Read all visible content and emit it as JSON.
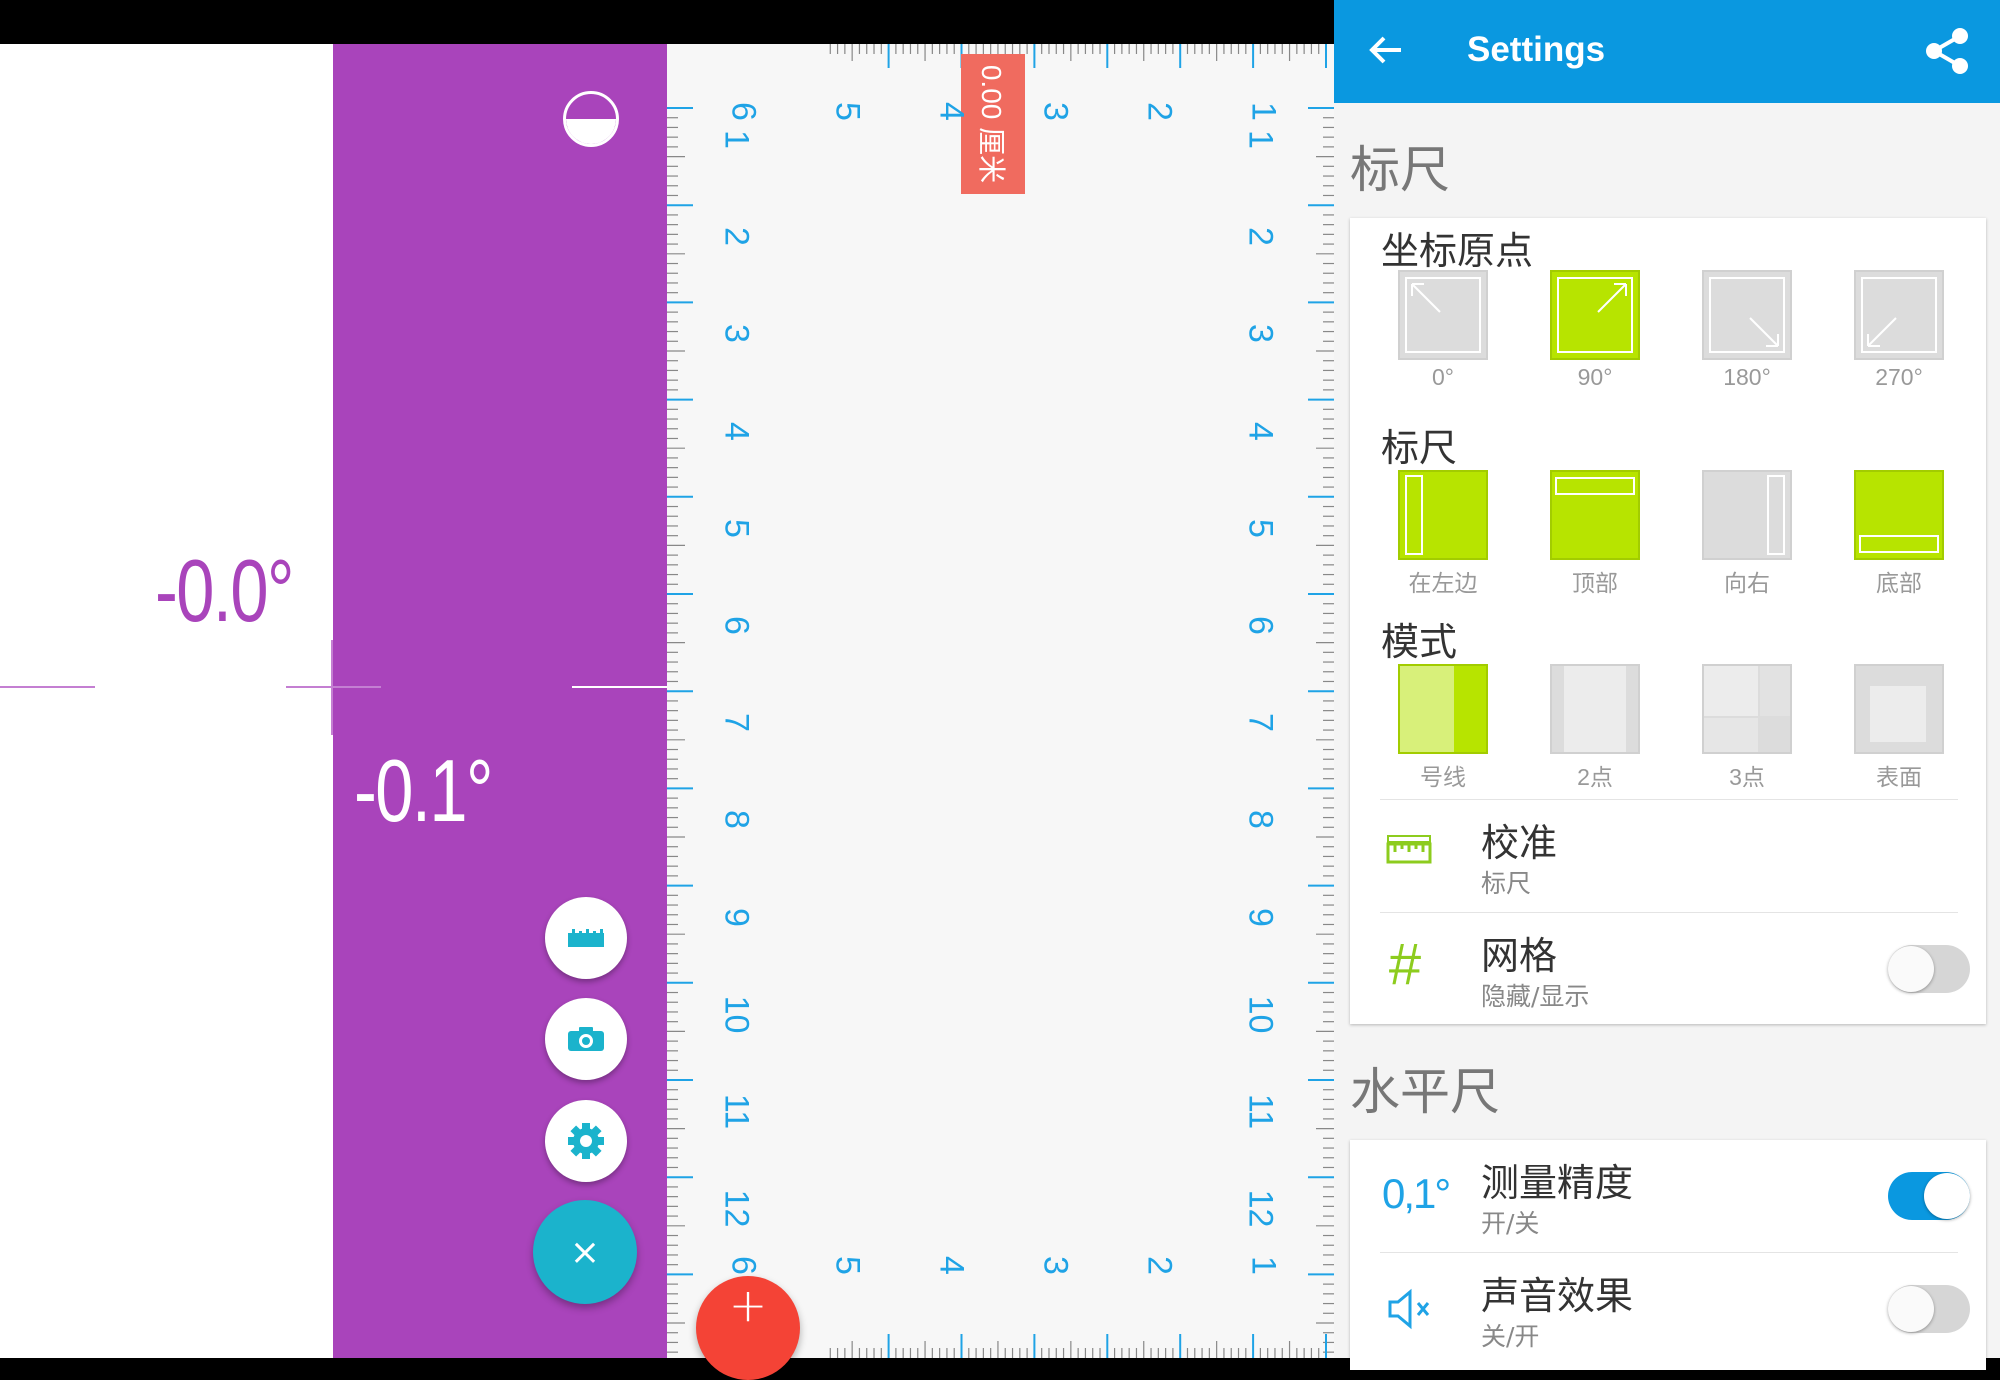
{
  "level": {
    "primary_angle": "-0.0°",
    "secondary_angle": "-0.1°",
    "accent_color": "#a944bb"
  },
  "ruler": {
    "measurement": "0.00 厘米",
    "left_numbers": [
      "1",
      "2",
      "3",
      "4",
      "5",
      "6",
      "7",
      "8",
      "9",
      "10",
      "11",
      "12"
    ],
    "top_numbers": [
      "1",
      "2",
      "3",
      "4",
      "5",
      "6"
    ],
    "bottom_numbers": [
      "1",
      "2",
      "3",
      "4",
      "5",
      "6"
    ],
    "tick_color": "#1fa3e6"
  },
  "fabs": {
    "ruler_icon": "ruler-icon",
    "camera_icon": "camera-icon",
    "settings_icon": "gear-icon",
    "close_label": "×",
    "add_label": "+"
  },
  "settings": {
    "title": "Settings",
    "section_ruler": "标尺",
    "origin": {
      "title": "坐标原点",
      "options": [
        "0°",
        "90°",
        "180°",
        "270°"
      ],
      "selected": 1
    },
    "ruler_position": {
      "title": "标尺",
      "options": [
        "在左边",
        "顶部",
        "向右",
        "底部"
      ],
      "selected": [
        0,
        1,
        3
      ]
    },
    "mode": {
      "title": "模式",
      "options": [
        "号线",
        "2点",
        "3点",
        "表面"
      ],
      "selected": 0
    },
    "calibrate": {
      "title": "校准",
      "subtitle": "标尺"
    },
    "grid": {
      "icon_text": "#",
      "title": "网格",
      "subtitle": "隐藏/显示",
      "enabled": false
    },
    "section_level": "水平尺",
    "precision": {
      "icon_text": "0,1°",
      "title": "测量精度",
      "subtitle": "开/关",
      "enabled": true
    },
    "sound": {
      "title": "声音效果",
      "subtitle": "关/开",
      "enabled": false
    },
    "accent_color": "#0a98e0",
    "selected_color": "#b7e400"
  }
}
